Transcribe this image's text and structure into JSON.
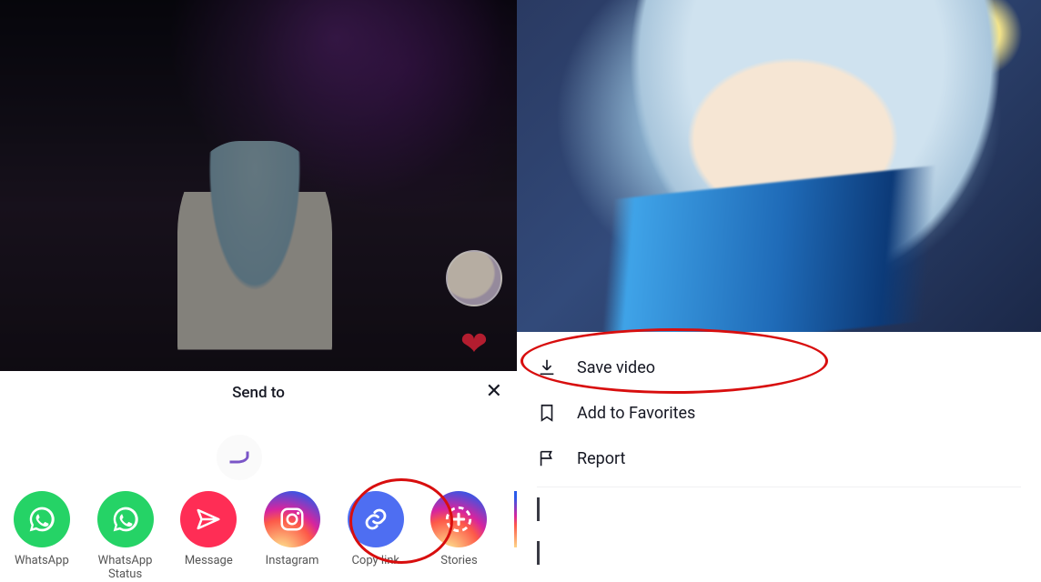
{
  "left": {
    "share_title": "Send to",
    "close_glyph": "✕",
    "apps": [
      {
        "name": "whatsapp",
        "label": "WhatsApp",
        "icon_class": "ic-whatsapp",
        "glyph": "wa"
      },
      {
        "name": "whatsapp-status",
        "label": "WhatsApp\nStatus",
        "icon_class": "ic-whatsapp",
        "glyph": "wa"
      },
      {
        "name": "message",
        "label": "Message",
        "icon_class": "ic-message",
        "glyph": "send"
      },
      {
        "name": "instagram",
        "label": "Instagram",
        "icon_class": "ic-instagram",
        "glyph": "ig"
      },
      {
        "name": "copy-link",
        "label": "Copy link",
        "icon_class": "ic-copylink",
        "glyph": "link"
      },
      {
        "name": "stories",
        "label": "Stories",
        "icon_class": "ic-stories",
        "glyph": "plus"
      }
    ],
    "highlighted_app": "copy-link"
  },
  "right": {
    "menu": [
      {
        "name": "save-video",
        "label": "Save video",
        "icon": "download"
      },
      {
        "name": "add-to-favorites",
        "label": "Add to Favorites",
        "icon": "bookmark"
      },
      {
        "name": "report",
        "label": "Report",
        "icon": "flag"
      }
    ],
    "highlighted_item": "save-video"
  },
  "colors": {
    "annotation_red": "#d80e0e",
    "whatsapp": "#25d366",
    "message": "#ff2d55",
    "copylink": "#4e6ef2"
  }
}
